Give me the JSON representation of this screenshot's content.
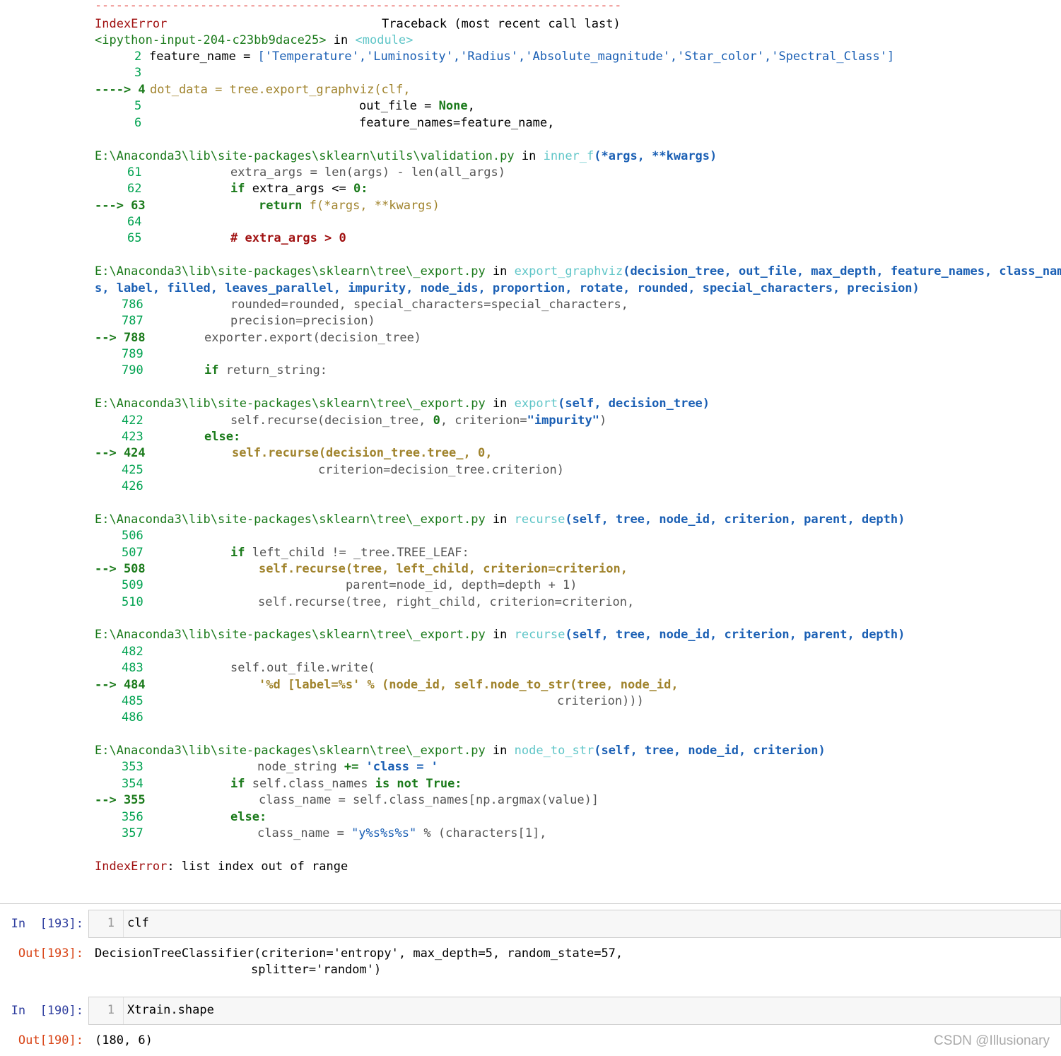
{
  "traceback": {
    "separator": "---------------------------------------------------------------------------",
    "error_type": "IndexError",
    "header_right": "Traceback (most recent call last)",
    "input_ref": "<ipython-input-204-c23bb9dace25>",
    "in_word": "in",
    "module_ref": "<module>",
    "frame0": {
      "l2n": "2",
      "l2a": "feature_name",
      "l2b": " = ",
      "l2c": "['Temperature','Luminosity','Radius','Absolute_magnitude','Star_color','Spectral_Class']",
      "l3n": "3",
      "l4arrow": "----> 4",
      "l4a": "dot_data",
      "l4b": " = ",
      "l4c": "tree.export_graphviz(clf,",
      "l5n": "5",
      "l5a": "out_file",
      "l5b": " = ",
      "l5c": "None",
      "l6n": "6",
      "l6a": "feature_names=feature_name,"
    },
    "frame1": {
      "path": "E:\\Anaconda3\\lib\\site-packages\\sklearn\\utils\\validation.py",
      "func": "inner_f",
      "args": "(*args, **kwargs)",
      "l61n": "61",
      "l61": "extra_args = len(args) - len(all_args)",
      "l62n": "62",
      "l62a": "if",
      "l62b": " extra_args <= ",
      "l62c": "0:",
      "l63arrow": "---> 63",
      "l63a": "return",
      "l63b": " f(*args, **kwargs)",
      "l64n": "64",
      "l65n": "65",
      "l65": "# extra_args > 0"
    },
    "frame2": {
      "path": "E:\\Anaconda3\\lib\\site-packages\\sklearn\\tree\\_export.py",
      "func": "export_graphviz",
      "args1": "(decision_tree, out_file, max_depth, feature_names, class_name",
      "args2": "s, label, filled, leaves_parallel, impurity, node_ids, proportion, rotate, rounded, special_characters, precision)",
      "l786n": "786",
      "l786": "rounded=rounded, special_characters=special_characters,",
      "l787n": "787",
      "l787": "precision=precision)",
      "l788arrow": "--> 788",
      "l788": "exporter.export(decision_tree)",
      "l789n": "789",
      "l790n": "790",
      "l790a": "if",
      "l790b": " return_string:"
    },
    "frame3": {
      "path": "E:\\Anaconda3\\lib\\site-packages\\sklearn\\tree\\_export.py",
      "func": "export",
      "args": "(self, decision_tree)",
      "l422n": "422",
      "l422a": "self.recurse(decision_tree, ",
      "l422b": "0",
      "l422c": ", criterion=",
      "l422d": "\"impurity\"",
      "l422e": ")",
      "l423n": "423",
      "l423": "else:",
      "l424arrow": "--> 424",
      "l424": "self.recurse(decision_tree.tree_, 0,",
      "l425n": "425",
      "l425": "criterion=decision_tree.criterion)",
      "l426n": "426"
    },
    "frame4": {
      "path": "E:\\Anaconda3\\lib\\site-packages\\sklearn\\tree\\_export.py",
      "func": "recurse",
      "args": "(self, tree, node_id, criterion, parent, depth)",
      "l506n": "506",
      "l507n": "507",
      "l507a": "if",
      "l507b": " left_child != _tree.TREE_LEAF:",
      "l508arrow": "--> 508",
      "l508": "self.recurse(tree, left_child, criterion=criterion,",
      "l509n": "509",
      "l509": "parent=node_id, depth=depth + 1)",
      "l510n": "510",
      "l510": "self.recurse(tree, right_child, criterion=criterion,"
    },
    "frame5": {
      "path": "E:\\Anaconda3\\lib\\site-packages\\sklearn\\tree\\_export.py",
      "func": "recurse",
      "args": "(self, tree, node_id, criterion, parent, depth)",
      "l482n": "482",
      "l483n": "483",
      "l483": "self.out_file.write(",
      "l484arrow": "--> 484",
      "l484": "'%d [label=%s' % (node_id, self.node_to_str(tree, node_id,",
      "l485n": "485",
      "l485": "criterion)))",
      "l486n": "486"
    },
    "frame6": {
      "path": "E:\\Anaconda3\\lib\\site-packages\\sklearn\\tree\\_export.py",
      "func": "node_to_str",
      "args": "(self, tree, node_id, criterion)",
      "l353n": "353",
      "l353a": "node_string ",
      "l353b": "+=",
      "l353c": " 'class = '",
      "l354n": "354",
      "l354a": "if",
      "l354b": " self.class_names ",
      "l354c": "is not True:",
      "l355arrow": "--> 355",
      "l355": "class_name = self.class_names[np.argmax(value)]",
      "l356n": "356",
      "l356": "else:",
      "l357n": "357",
      "l357a": "class_name = ",
      "l357b": "\"y%s%s%s\"",
      "l357c": " % (characters[1],"
    },
    "final_error": "IndexError",
    "final_msg": ": list index out of range"
  },
  "cells": [
    {
      "in_prompt": "In  [193]:",
      "line_no": "1",
      "code": "clf",
      "out_prompt": "Out[193]:",
      "out_l1": "DecisionTreeClassifier(criterion='entropy', max_depth=5, random_state=57,",
      "out_l2": "splitter='random')"
    },
    {
      "in_prompt": "In  [190]:",
      "line_no": "1",
      "code": "Xtrain.shape",
      "out_prompt": "Out[190]:",
      "out_l1": "(180, 6)"
    }
  ],
  "watermark": "CSDN @Illusionary",
  "colors": {
    "module": "#60c6c8",
    "path": "#00a250",
    "error": "#a01010",
    "keyword": "#1a7a1a",
    "string": "#1a5fb4",
    "arrow_line": "#a0832c"
  }
}
